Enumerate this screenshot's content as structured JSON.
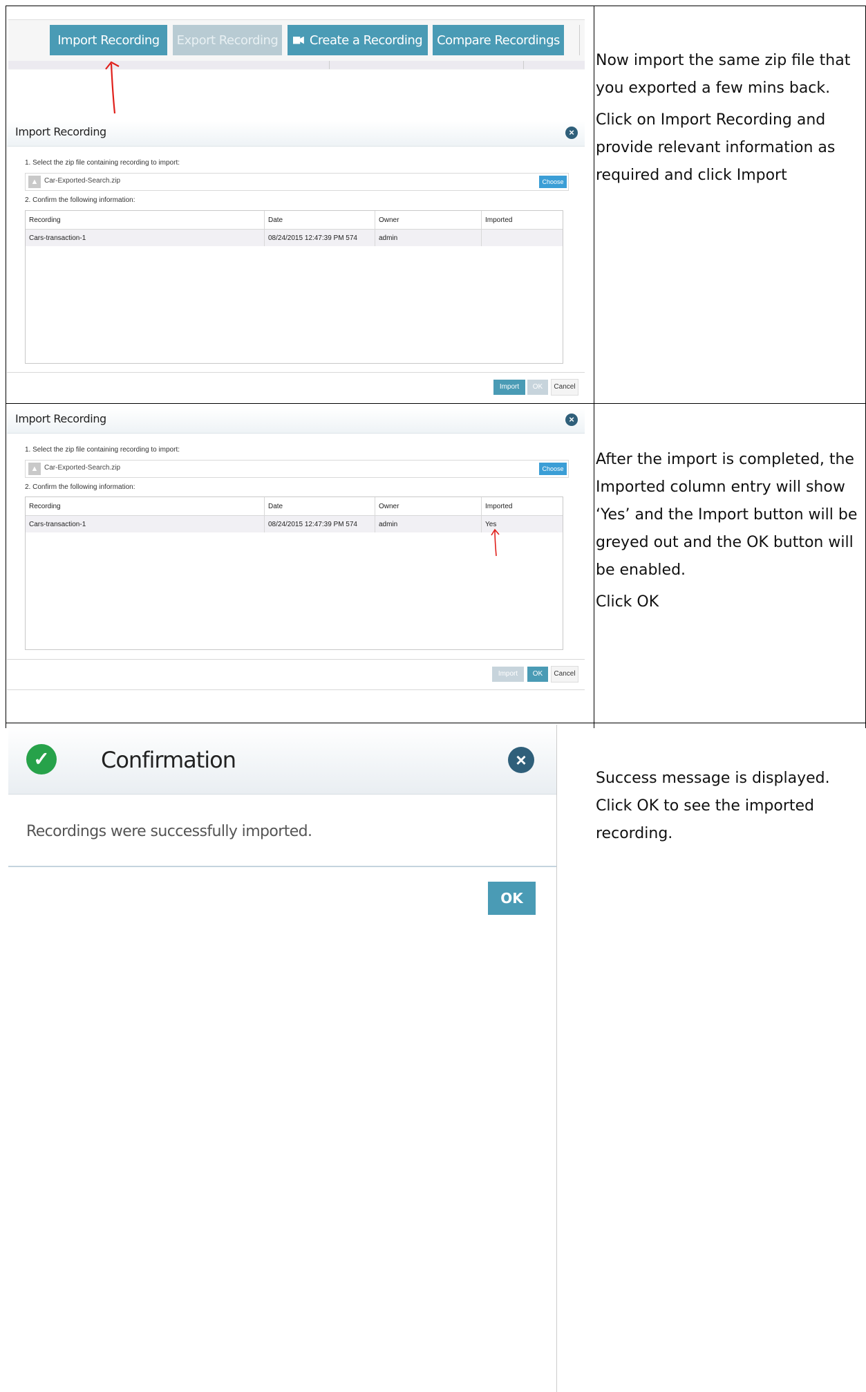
{
  "toolbar": {
    "import_label": "Import Recording",
    "export_label": "Export Recording",
    "create_label": "Create a Recording",
    "compare_label": "Compare Recordings"
  },
  "dialog": {
    "title": "Import Recording",
    "step1": "1. Select the zip file containing recording to import:",
    "file_name": "Car-Exported-Search.zip",
    "choose_label": "Choose",
    "step2": "2. Confirm the following information:",
    "columns": [
      "Recording",
      "Date",
      "Owner",
      "Imported"
    ],
    "row": {
      "recording": "Cars-transaction-1",
      "date": "08/24/2015 12:47:39 PM 574",
      "owner": "admin",
      "imported_before": "",
      "imported_after": "Yes"
    },
    "import_label": "Import",
    "ok_label": "OK",
    "cancel_label": "Cancel"
  },
  "confirmation": {
    "title": "Confirmation",
    "message": "Recordings were successfully imported.",
    "ok_label": "OK"
  },
  "notes": {
    "row1_p1": "Now import the same zip file that you exported a few mins back.",
    "row1_p2": "Click on Import Recording and provide relevant information as required and click Import",
    "row2_p1": "After the import is completed, the Imported column entry will show ‘Yes’ and the Import button will be greyed out and the OK button will be enabled.",
    "row2_p2": "Click OK",
    "row3_p1": "Success message is displayed. Click OK to see the imported recording."
  },
  "colors": {
    "accent": "#4a9bb5",
    "disabled": "#c7d4dc",
    "success": "#27a24a",
    "annotation_arrow": "#e0201b"
  }
}
